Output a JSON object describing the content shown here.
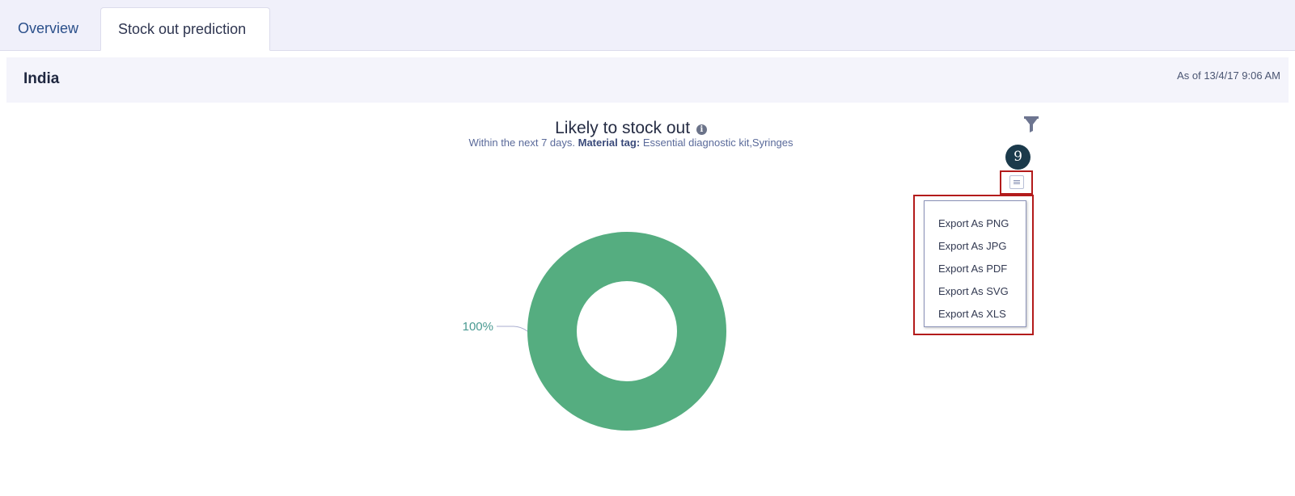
{
  "tabs": [
    {
      "label": "Overview",
      "active": false
    },
    {
      "label": "Stock out prediction",
      "active": true
    }
  ],
  "header": {
    "region": "India",
    "as_of": "As of 13/4/17 9:06 AM"
  },
  "chart": {
    "title": "Likely to stock out",
    "subtitle_prefix": "Within the next 7 days.",
    "subtitle_tag_label": "Material tag:",
    "subtitle_tag_value": "Essential diagnostic kit,Syringes",
    "icons": [
      "info-icon",
      "filter-icon",
      "menu-icon"
    ]
  },
  "step_badge": "9",
  "export_menu": {
    "items": [
      "Export As PNG",
      "Export As JPG",
      "Export As PDF",
      "Export As SVG",
      "Export As XLS"
    ]
  },
  "chart_data": {
    "type": "pie",
    "donut": true,
    "title": "Likely to stock out",
    "slices": [
      {
        "value": 100,
        "label": "100%",
        "color": "#55ad80"
      }
    ]
  },
  "colors": {
    "donut": "#55ad80",
    "highlight_border": "#b31b1b",
    "badge": "#1b3a4b",
    "label": "#4a9a92"
  }
}
